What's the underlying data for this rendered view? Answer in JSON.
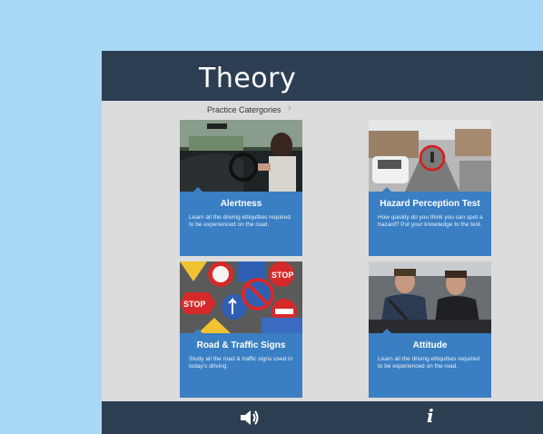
{
  "header": {
    "title": "Theory"
  },
  "breadcrumb": {
    "label": "Practice Catergories",
    "chevron": "›"
  },
  "cards": [
    {
      "title": "Alertness",
      "description": "Learn all the driving ettiqutties required to be experienced on the road.",
      "image_icon": "car-interior-photo"
    },
    {
      "title": "Hazard Perception Test",
      "description": "How quickly do you think you can spot a hazard? Put your knowledge to the test.",
      "image_icon": "street-hazard-photo"
    },
    {
      "title": "Road & Traffic Signs",
      "description": "Study all the road & traffic signs used in today's driving.",
      "image_icon": "traffic-signs-photo"
    },
    {
      "title": "Attitude",
      "description": "Learn all the driving ettiqutties required to be experienced on the road.",
      "image_icon": "driving-instructor-photo"
    }
  ],
  "footer": {
    "sound_icon": "speaker-icon",
    "info_label": "i"
  },
  "colors": {
    "header_bg": "#2c3e52",
    "card_bg": "#3a7fc3",
    "page_bg": "#a9d8f6",
    "content_bg": "#dcdcdc"
  }
}
